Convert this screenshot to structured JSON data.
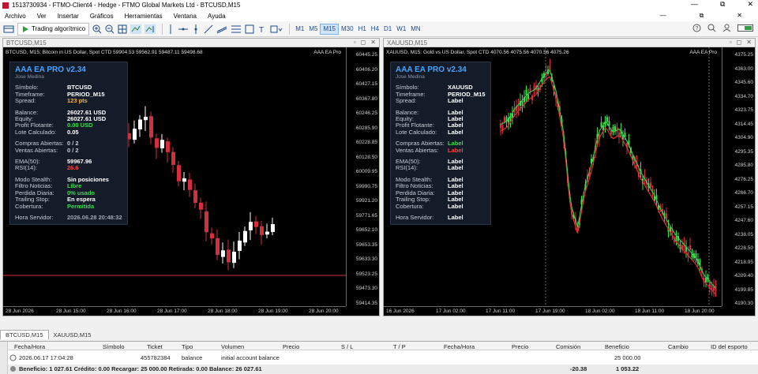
{
  "window": {
    "title": "1513730934 - FTMO-Client4 - Hedge - FTMO Global Markets Ltd - BTCUSD,M15",
    "controls": [
      "—",
      "⧉",
      "✕"
    ]
  },
  "menu": {
    "items": [
      "Archivo",
      "Ver",
      "Insertar",
      "Gráficos",
      "Herramientas",
      "Ventana",
      "Ayuda"
    ],
    "window_controls": [
      "—",
      "⧉",
      "✕"
    ]
  },
  "toolbar": {
    "algo_label": "Trading algorítmico",
    "timeframes": [
      "M1",
      "M5",
      "M15",
      "M30",
      "H1",
      "H4",
      "D1",
      "W1",
      "MN"
    ],
    "active_timeframe": "M15"
  },
  "chart_left": {
    "window_title": "BTCUSD,M15",
    "symbol_info": "BTCUSD, M15:  Bitcoin in US Dollar, Spot CTD  59904.53 59562.91 59487.11 59498.68",
    "ea_tag": "AAA EA Pro",
    "panel": {
      "title": "AAA EA PRO v2.34",
      "subtitle": "Jose Medina",
      "rows": [
        {
          "k": "Símbolo:",
          "v": "BTCUSD",
          "color": "#ffffff"
        },
        {
          "k": "Timeframe:",
          "v": "PERIOD_M15",
          "color": "#ffffff"
        },
        {
          "k": "Spread:",
          "v": "123 pts",
          "color": "#f5b342"
        },
        {
          "gap": true
        },
        {
          "k": "Balance:",
          "v": "26027.61 USD",
          "color": "#ffffff"
        },
        {
          "k": "Equity:",
          "v": "26027.61 USD",
          "color": "#ffffff"
        },
        {
          "k": "Profit Flotante:",
          "v": "0.00 USD",
          "color": "#3ddc4f"
        },
        {
          "k": "Lote Calculado:",
          "v": "0.05",
          "color": "#ffffff"
        },
        {
          "gap": true
        },
        {
          "k": "Compras Abiertas:",
          "v": "0 / 2",
          "color": "#c8ccd4"
        },
        {
          "k": "Ventas Abiertas:",
          "v": "0 / 2",
          "color": "#c8ccd4"
        },
        {
          "gap": true
        },
        {
          "k": "EMA(50):",
          "v": "59967.96",
          "color": "#ffffff"
        },
        {
          "k": "RSI(14):",
          "v": "26.6",
          "color": "#ff4040"
        },
        {
          "gap": true
        },
        {
          "k": "Modo Stealth:",
          "v": "Sin posiciones",
          "color": "#ffffff"
        },
        {
          "k": "Filtro Noticias:",
          "v": "Libre",
          "color": "#3ddc4f"
        },
        {
          "k": "Perdida Diaria:",
          "v": "0% usado",
          "color": "#3ddc4f"
        },
        {
          "k": "Trailing Stop:",
          "v": "En espera",
          "color": "#ffffff"
        },
        {
          "k": "Cobertura:",
          "v": "Permitida",
          "color": "#3ddc4f"
        },
        {
          "gap": true
        },
        {
          "k": "Hora Servidor:",
          "v": "2026.06.28 20:48:32",
          "color": "#a0a6b4"
        }
      ]
    },
    "price_labels": [
      "60445.25",
      "60406.20",
      "60427.15",
      "60367.80",
      "60246.25",
      "60285.90",
      "60228.85",
      "60128.50",
      "60009.95",
      "59990.75",
      "59921.20",
      "59771.65",
      "59652.10",
      "59653.35",
      "59633.30",
      "59523.25",
      "59473.30",
      "59414.35"
    ],
    "current_price": "59498.68",
    "time_labels": [
      "28 Jun 2026",
      "28 Jun 15:00",
      "28 Jun 16:00",
      "28 Jun 17:00",
      "28 Jun 18:00",
      "28 Jun 19:00",
      "28 Jun 20:00"
    ]
  },
  "chart_right": {
    "window_title": "XAUUSD,M15",
    "symbol_info": "XAUUSD, M15:  Gold vs US Dollar, Spot CTD  4070.56 4075.56 4070.56 4075.26",
    "ea_tag": "AAA EA Pro",
    "panel": {
      "title": "AAA EA PRO v2.34",
      "subtitle": "Jose Medina",
      "rows": [
        {
          "k": "Símbolo:",
          "v": "XAUUSD",
          "color": "#ffffff"
        },
        {
          "k": "Timeframe:",
          "v": "PERIOD_M15",
          "color": "#ffffff"
        },
        {
          "k": "Spread:",
          "v": "Label",
          "color": "#ffffff"
        },
        {
          "gap": true
        },
        {
          "k": "Balance:",
          "v": "Label",
          "color": "#ffffff"
        },
        {
          "k": "Equity:",
          "v": "Label",
          "color": "#ffffff"
        },
        {
          "k": "Profit Flotante:",
          "v": "Label",
          "color": "#ffffff"
        },
        {
          "k": "Lote Calculado:",
          "v": "Label",
          "color": "#ffffff"
        },
        {
          "gap": true
        },
        {
          "k": "Compras Abiertas:",
          "v": "Label",
          "color": "#3ddc4f"
        },
        {
          "k": "Ventas Abiertas:",
          "v": "Label",
          "color": "#ff4040"
        },
        {
          "gap": true
        },
        {
          "k": "EMA(50):",
          "v": "Label",
          "color": "#ffffff"
        },
        {
          "k": "RSI(14):",
          "v": "Label",
          "color": "#ffffff"
        },
        {
          "gap": true
        },
        {
          "k": "Modo Stealth:",
          "v": "Label",
          "color": "#ffffff"
        },
        {
          "k": "Filtro Noticias:",
          "v": "Label",
          "color": "#ffffff"
        },
        {
          "k": "Perdida Diaria:",
          "v": "Label",
          "color": "#ffffff"
        },
        {
          "k": "Trailing Stop:",
          "v": "Label",
          "color": "#ffffff"
        },
        {
          "k": "Cobertura:",
          "v": "Label",
          "color": "#ffffff"
        },
        {
          "gap": true
        },
        {
          "k": "Hora Servidor:",
          "v": "Label",
          "color": "#ffffff"
        }
      ]
    },
    "price_labels": [
      "4375.25",
      "4363.00",
      "4345.60",
      "4334.70",
      "4323.75",
      "4314.45",
      "4304.90",
      "4295.35",
      "4285.80",
      "4276.25",
      "4266.70",
      "4257.15",
      "4247.60",
      "4238.05",
      "4228.50",
      "4218.95",
      "4209.40",
      "4199.85",
      "4190.30"
    ],
    "time_labels": [
      "16 Jun 2026",
      "17 Jun 02:00",
      "17 Jun 11:00",
      "17 Jun 19:00",
      "18 Jun 02:00",
      "18 Jun 11:00",
      "18 Jun 20:00"
    ]
  },
  "tabs": [
    "BTCUSD,M15",
    "XAUUSD,M15"
  ],
  "terminal": {
    "headers": [
      "Fecha/Hora",
      "Símbolo",
      "Ticket",
      "Tipo",
      "Volumen",
      "Precio",
      "S / L",
      "T / P",
      "Fecha/Hora",
      "Precio",
      "Comisión",
      "Beneficio",
      "Cambio",
      "ID del esporto"
    ],
    "row": {
      "date": "2026.06.17 17:04:28",
      "ticket": "455782384",
      "type": "balance",
      "comment": "initial account balance",
      "profit": "25 000.00"
    },
    "summary": {
      "text": "Beneficio: 1 027.61  Crédito: 0.00  Recargar: 25 000.00  Retirada: 0.00  Balance: 26 027.61",
      "commission": "-20.38",
      "profit": "1 053.22"
    }
  },
  "colors": {
    "bull": "#ffffff",
    "bear": "#d32f3f",
    "ema": "#e0302f",
    "fast": "#3ddc4f"
  }
}
